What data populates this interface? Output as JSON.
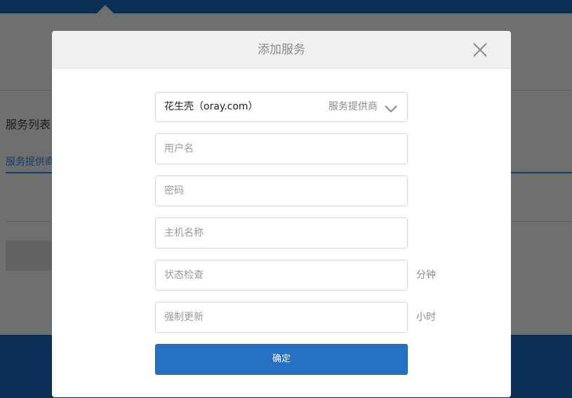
{
  "background": {
    "section_title": "服务列表",
    "tab_label": "服务提供商"
  },
  "modal": {
    "title": "添加服务",
    "provider_select": {
      "value": "花生壳（oray.com）",
      "label": "服务提供商"
    },
    "fields": {
      "username_placeholder": "用户名",
      "password_placeholder": "密码",
      "hostname_placeholder": "主机名称",
      "status_check_placeholder": "状态检查",
      "status_check_unit": "分钟",
      "force_update_placeholder": "强制更新",
      "force_update_unit": "小时"
    },
    "confirm_label": "确定"
  },
  "icons": {
    "close": "close-icon",
    "dropdown": "chevron-down-icon"
  },
  "colors": {
    "primary_button": "#2771c2",
    "header_bar": "#0a2f55"
  }
}
